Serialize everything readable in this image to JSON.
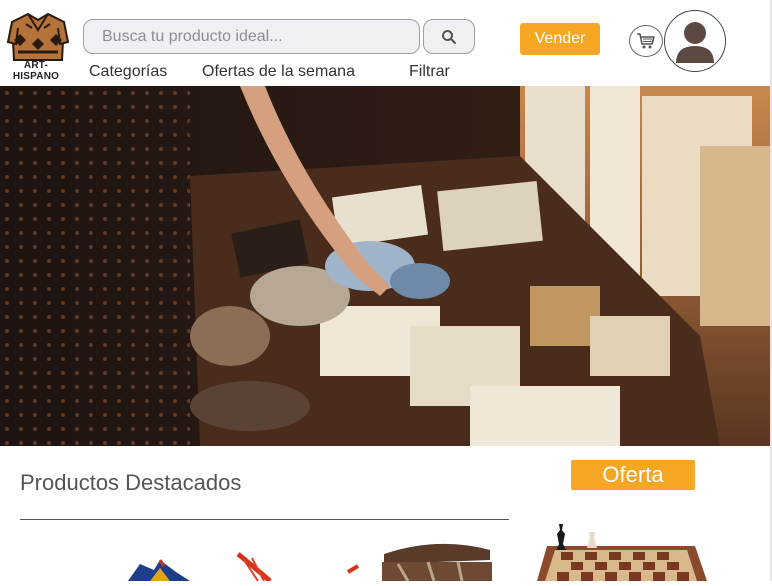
{
  "header": {
    "logo_text": "ART- HISPANO",
    "search_placeholder": "Busca tu producto ideal...",
    "sell_label": "Vender",
    "nav": [
      {
        "label": "Categorías"
      },
      {
        "label": "Ofertas de la semana"
      },
      {
        "label": "Filtrar"
      }
    ]
  },
  "icons": {
    "search": "search-icon",
    "cart": "cart-icon",
    "avatar": "user-avatar-icon",
    "logo": "poncho-logo-icon"
  },
  "featured": {
    "title": "Productos Destacados",
    "offer_label": "Oferta"
  },
  "colors": {
    "accent": "#f5a623",
    "input_bg": "#eef0f3"
  }
}
